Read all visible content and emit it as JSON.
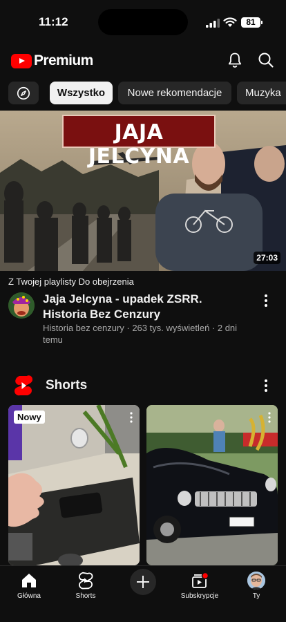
{
  "status_bar": {
    "time": "11:12",
    "battery": "81"
  },
  "header": {
    "logo_text": "Premium",
    "brand_color": "#ff0000",
    "icons": [
      "bell-icon",
      "search-icon"
    ]
  },
  "chips": {
    "explore_icon": "compass-icon",
    "items": [
      {
        "label": "Wszystko",
        "active": true
      },
      {
        "label": "Nowe rekomendacje",
        "active": false
      },
      {
        "label": "Muzyka",
        "active": false
      }
    ]
  },
  "featured": {
    "thumbnail_title": "JAJA JELCYNA",
    "duration": "27:03",
    "playlist_label": "Z Twojej playlisty Do obejrzenia",
    "title": "Jaja Jelcyna - upadek ZSRR. Historia Bez Cenzury",
    "meta": "Historia bez cenzury · 263 tys. wyświetleń · 2 dni temu"
  },
  "shorts": {
    "section_title": "Shorts",
    "cards": [
      {
        "badge": "Nowy"
      },
      {
        "badge": ""
      }
    ]
  },
  "bottom_nav": {
    "items": [
      {
        "label": "Główna",
        "icon": "home-icon"
      },
      {
        "label": "Shorts",
        "icon": "shorts-icon"
      },
      {
        "label": "",
        "icon": "create-icon"
      },
      {
        "label": "Subskrypcje",
        "icon": "subscriptions-icon"
      },
      {
        "label": "Ty",
        "icon": "avatar"
      }
    ]
  }
}
